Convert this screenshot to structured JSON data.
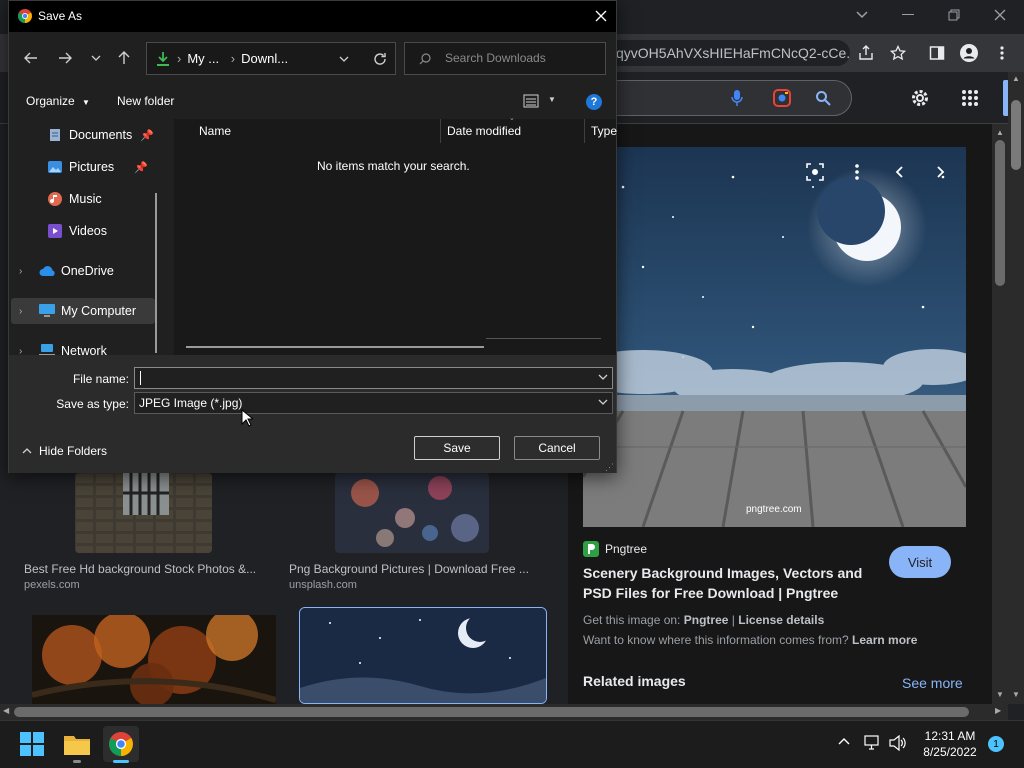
{
  "chrome": {
    "omnibox_url": "qyvOH5AhVXsHIEHaFmCNcQ2-cCe...",
    "window_controls": [
      "chevron-down",
      "minimize",
      "restore",
      "close"
    ]
  },
  "results": [
    {
      "title": "Best Free Hd background Stock Photos &...",
      "source": "pexels.com"
    },
    {
      "title": "Png Background Pictures | Download Free ...",
      "source": "unsplash.com"
    }
  ],
  "preview": {
    "watermark": "pngtree.com",
    "source_name": "Pngtree",
    "title": "Scenery Background Images, Vectors and PSD Files for Free Download | Pngtree",
    "visit_label": "Visit",
    "get_image_prefix": "Get this image on:",
    "get_image_site": "Pngtree",
    "license_details": "License details",
    "want_to_know": "Want to know where this information comes from?",
    "learn_more": "Learn more",
    "related_images": "Related images",
    "see_more": "See more"
  },
  "dialog": {
    "title": "Save As",
    "address": {
      "segment1": "My ...",
      "segment2": "Downl..."
    },
    "search_placeholder": "Search Downloads",
    "organize_label": "Organize",
    "new_folder_label": "New folder",
    "nav_items": [
      {
        "label": "Documents",
        "pinned": true,
        "icon": "documents-icon"
      },
      {
        "label": "Pictures",
        "pinned": true,
        "icon": "pictures-icon"
      },
      {
        "label": "Music",
        "pinned": false,
        "icon": "music-icon"
      },
      {
        "label": "Videos",
        "pinned": false,
        "icon": "videos-icon"
      },
      {
        "label": "OneDrive",
        "expandable": true,
        "icon": "onedrive-icon"
      },
      {
        "label": "My Computer",
        "expandable": true,
        "selected": true,
        "icon": "computer-icon"
      },
      {
        "label": "Network",
        "expandable": true,
        "icon": "network-icon"
      }
    ],
    "columns": [
      "Name",
      "Date modified",
      "Type"
    ],
    "empty_message": "No items match your search.",
    "file_name_label": "File name:",
    "file_name_value": "",
    "save_type_label": "Save as type:",
    "save_type_value": "JPEG Image (*.jpg)",
    "hide_folders_label": "Hide Folders",
    "save_label": "Save",
    "cancel_label": "Cancel"
  },
  "taskbar": {
    "time": "12:31 AM",
    "date": "8/25/2022",
    "notification_count": "1"
  },
  "colors": {
    "accent": "#8ab4f8",
    "dialog_bg": "#202020",
    "page_bg": "#202124"
  }
}
